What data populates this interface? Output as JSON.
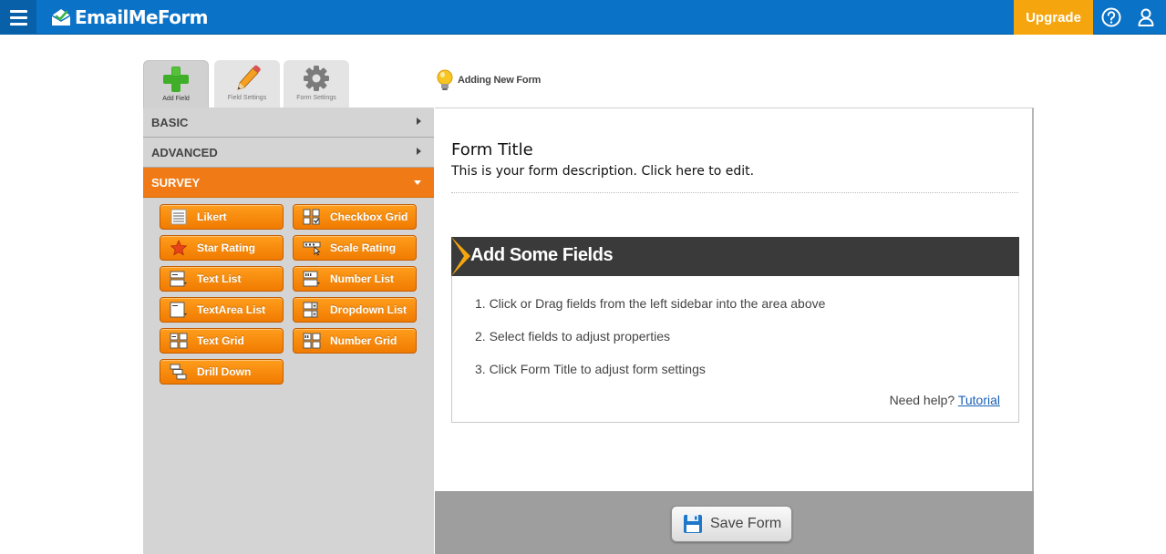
{
  "header": {
    "logo_text": "EmailMeForm",
    "upgrade_label": "Upgrade",
    "help_icon": "question-circle-icon",
    "user_icon": "user-icon",
    "brand_color": "#0a72c7",
    "accent_color": "#f5a60f"
  },
  "tabs": [
    {
      "label": "Add Field",
      "icon": "plus-icon"
    },
    {
      "label": "Field Settings",
      "icon": "pencil-icon"
    },
    {
      "label": "Form Settings",
      "icon": "gear-icon"
    }
  ],
  "hint": {
    "text": "Adding New Form",
    "icon": "lightbulb-icon"
  },
  "sidebar": {
    "sections": [
      {
        "label": "BASIC",
        "open": false
      },
      {
        "label": "ADVANCED",
        "open": false
      },
      {
        "label": "SURVEY",
        "open": true
      }
    ],
    "survey_fields": [
      {
        "label": "Likert",
        "icon": "likert-icon"
      },
      {
        "label": "Checkbox Grid",
        "icon": "checkbox-grid-icon"
      },
      {
        "label": "Star Rating",
        "icon": "star-icon"
      },
      {
        "label": "Scale Rating",
        "icon": "scale-rating-icon"
      },
      {
        "label": "Text List",
        "icon": "text-list-icon"
      },
      {
        "label": "Number List",
        "icon": "number-list-icon"
      },
      {
        "label": "TextArea List",
        "icon": "textarea-list-icon"
      },
      {
        "label": "Dropdown List",
        "icon": "dropdown-list-icon"
      },
      {
        "label": "Text Grid",
        "icon": "text-grid-icon"
      },
      {
        "label": "Number Grid",
        "icon": "number-grid-icon"
      },
      {
        "label": "Drill Down",
        "icon": "drill-down-icon"
      }
    ]
  },
  "form": {
    "title": "Form Title",
    "description": "This is your form description. Click here to edit."
  },
  "add_fields": {
    "title": "Add Some Fields",
    "steps": [
      "1. Click or Drag fields from the left sidebar into the area above",
      "2. Select fields to adjust properties",
      "3. Click Form Title to adjust form settings"
    ],
    "help_prefix": "Need help?",
    "help_link": "Tutorial"
  },
  "save": {
    "label": "Save Form",
    "icon": "floppy-disk-icon"
  }
}
